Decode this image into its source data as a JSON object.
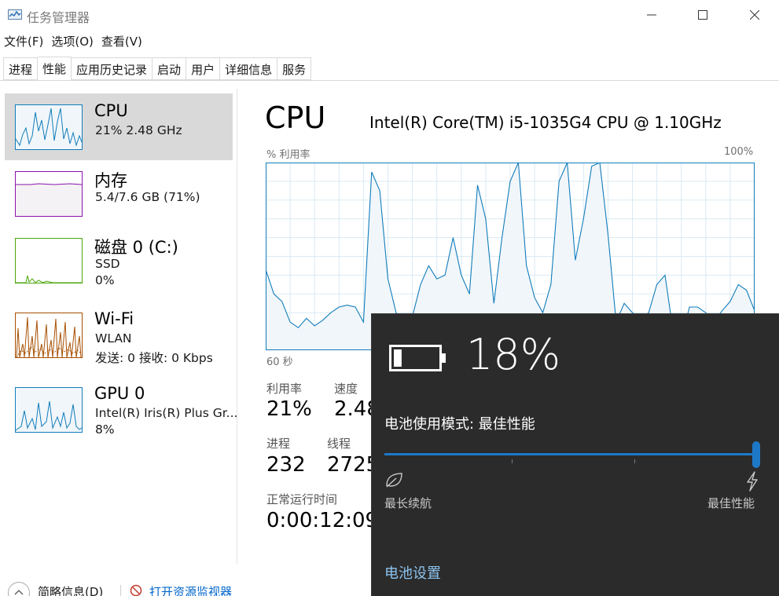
{
  "window": {
    "title": "任务管理器",
    "controls": {
      "minimize": "—",
      "maximize": "☐",
      "close": "✕"
    }
  },
  "menu": [
    "文件(F)",
    "选项(O)",
    "查看(V)"
  ],
  "tabs": [
    {
      "label": "进程",
      "active": false
    },
    {
      "label": "性能",
      "active": true
    },
    {
      "label": "应用历史记录",
      "active": false
    },
    {
      "label": "启动",
      "active": false
    },
    {
      "label": "用户",
      "active": false
    },
    {
      "label": "详细信息",
      "active": false
    },
    {
      "label": "服务",
      "active": false
    }
  ],
  "sidebar": {
    "items": [
      {
        "name": "CPU",
        "line1": "21%  2.48 GHz",
        "line2": "",
        "line3": "",
        "selected": true,
        "color": "#117dbb",
        "fill": "#f1f6fa"
      },
      {
        "name": "内存",
        "line1": "5.4/7.6 GB (71%)",
        "line2": "",
        "line3": "",
        "selected": false,
        "color": "#8b12ae",
        "fill": "#f4f2f4"
      },
      {
        "name": "磁盘 0 (C:)",
        "line1": "SSD",
        "line2": "0%",
        "line3": "",
        "selected": false,
        "color": "#4da60c",
        "fill": "#eff7ea"
      },
      {
        "name": "Wi-Fi",
        "line1": "WLAN",
        "line2": "发送: 0 接收: 0 Kbps",
        "line3": "",
        "selected": false,
        "color": "#a74f01",
        "fill": "#fcf3eb"
      },
      {
        "name": "GPU 0",
        "line1": "Intel(R) Iris(R) Plus Gr...",
        "line2": "8%",
        "line3": "",
        "selected": false,
        "color": "#117dbb",
        "fill": "#f1f6fa"
      }
    ]
  },
  "main": {
    "title": "CPU",
    "model": "Intel(R) Core(TM) i5-1035G4 CPU @ 1.10GHz",
    "util_label": "% 利用率",
    "max_label": "100%",
    "time_label": "60 秒",
    "stats": {
      "utilization_label": "利用率",
      "utilization": "21%",
      "speed_label": "速度",
      "speed": "2.48",
      "processes_label": "进程",
      "processes": "232",
      "threads_label": "线程",
      "threads": "2725",
      "uptime_label": "正常运行时间",
      "uptime": "0:00:12:09"
    }
  },
  "footer": {
    "collapse": "简略信息(D)",
    "monitor": "打开资源监视器"
  },
  "battery": {
    "percent": "18%",
    "level": 0.18,
    "mode_label": "电池使用模式: 最佳性能",
    "slider_value": 1.0,
    "min_label": "最长续航",
    "max_label": "最佳性能",
    "settings_link": "电池设置",
    "accent": "#1e78c8"
  },
  "chart_data": {
    "type": "area",
    "title": "",
    "ylabel": "% 利用率",
    "xlabel": "60 秒",
    "ylim": [
      0,
      100
    ],
    "xlim": [
      0,
      60
    ],
    "series": [
      {
        "values": [
          43,
          30,
          26,
          15,
          12,
          17,
          13,
          16,
          20,
          23,
          24,
          23,
          15,
          95,
          85,
          38,
          20,
          15,
          18,
          35,
          45,
          38,
          40,
          60,
          40,
          30,
          88,
          70,
          25,
          60,
          90,
          100,
          45,
          28,
          20,
          35,
          90,
          100,
          48,
          70,
          98,
          100,
          62,
          15,
          25,
          20,
          16,
          20,
          35,
          40,
          10,
          5,
          23,
          23,
          20,
          15,
          21,
          26,
          35,
          32,
          21
        ]
      }
    ]
  }
}
